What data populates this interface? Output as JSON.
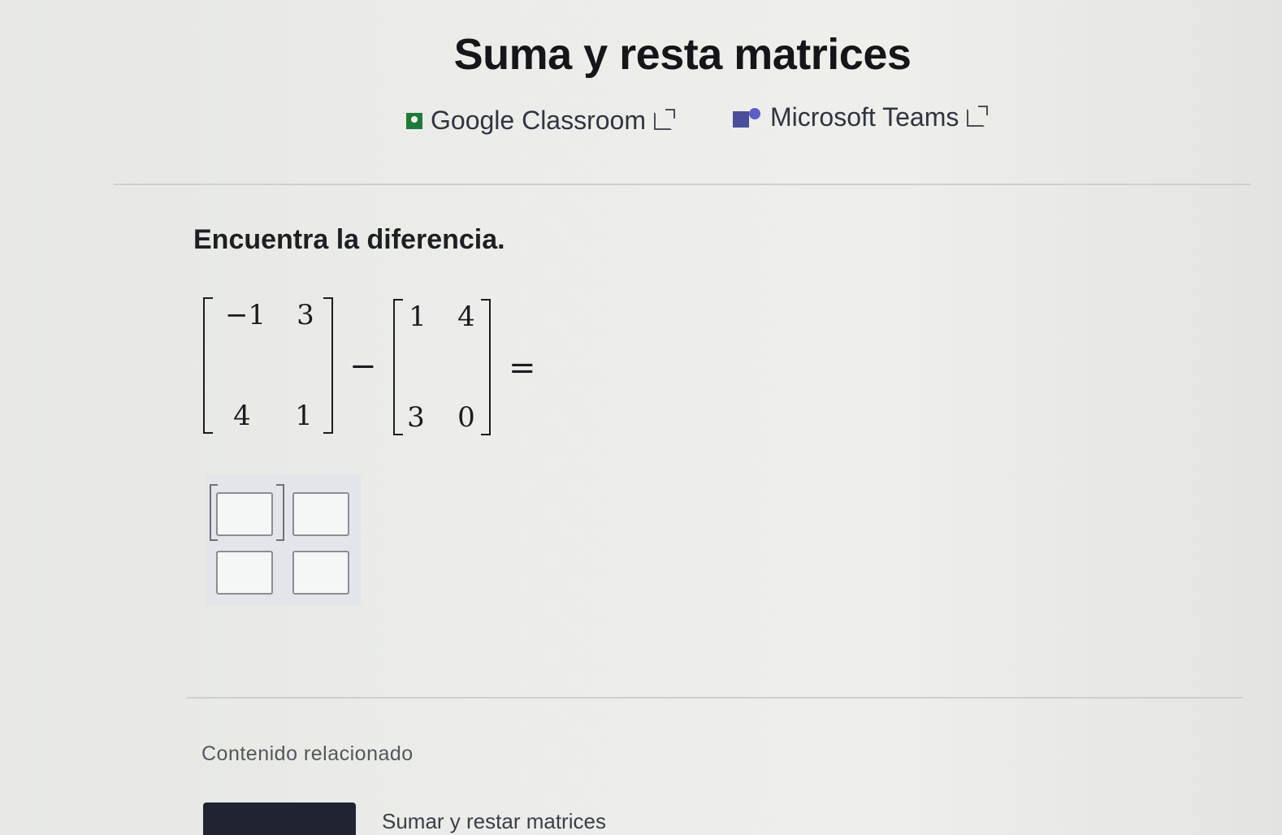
{
  "page": {
    "title": "Suma y resta matrices"
  },
  "share": {
    "classroom_label": "Google Classroom",
    "teams_label": "Microsoft Teams"
  },
  "exercise": {
    "prompt": "Encuentra la diferencia.",
    "matrix_a": [
      [
        "−1",
        "3"
      ],
      [
        "4",
        "1"
      ]
    ],
    "matrix_b": [
      [
        "1",
        "4"
      ],
      [
        "3",
        "0"
      ]
    ],
    "operator": "−",
    "equals": "=",
    "answer": [
      [
        "",
        ""
      ],
      [
        "",
        ""
      ]
    ]
  },
  "related": {
    "heading": "Contenido relacionado",
    "items": [
      {
        "label": "Sumar y restar matrices"
      }
    ]
  }
}
